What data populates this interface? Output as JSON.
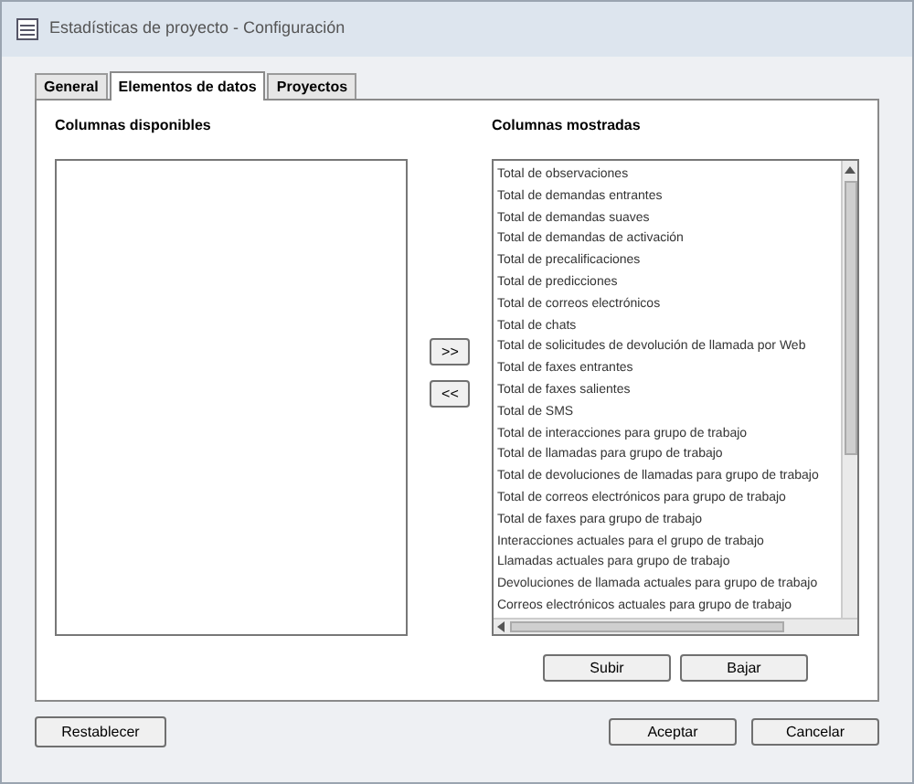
{
  "window": {
    "title": "Estadísticas de proyecto - Configuración"
  },
  "tabs": [
    {
      "label": "General",
      "selected": false
    },
    {
      "label": "Elementos de datos",
      "selected": true
    },
    {
      "label": "Proyectos",
      "selected": false
    }
  ],
  "available": {
    "label": "Columnas disponibles"
  },
  "move_buttons": [
    ">>",
    "<<"
  ],
  "shown": {
    "label": "Columnas mostradas",
    "items": [
      "Total de observaciones",
      "Total de demandas entrantes",
      "Total de demandas suaves",
      "Total de demandas de activación",
      "Total de precalificaciones",
      "Total de predicciones",
      "Total de correos electrónicos",
      "Total de chats",
      "Total de solicitudes de devolución de llamada por Web",
      "Total de faxes entrantes",
      "Total de faxes salientes",
      "Total de SMS",
      "Total de interacciones para grupo de trabajo",
      "Total de llamadas para grupo de trabajo",
      "Total de devoluciones de llamadas para grupo de trabajo",
      "Total de correos electrónicos para grupo de trabajo",
      "Total de faxes para grupo de trabajo",
      "Interacciones actuales para el grupo de trabajo",
      "Llamadas actuales para grupo de trabajo",
      "Devoluciones de llamada actuales para grupo de trabajo",
      "Correos electrónicos actuales para grupo de trabajo"
    ]
  },
  "order_buttons": [
    "Subir",
    "Bajar"
  ],
  "footer": {
    "reset": "Restablecer",
    "buttons": [
      "Aceptar",
      "Cancelar"
    ]
  }
}
